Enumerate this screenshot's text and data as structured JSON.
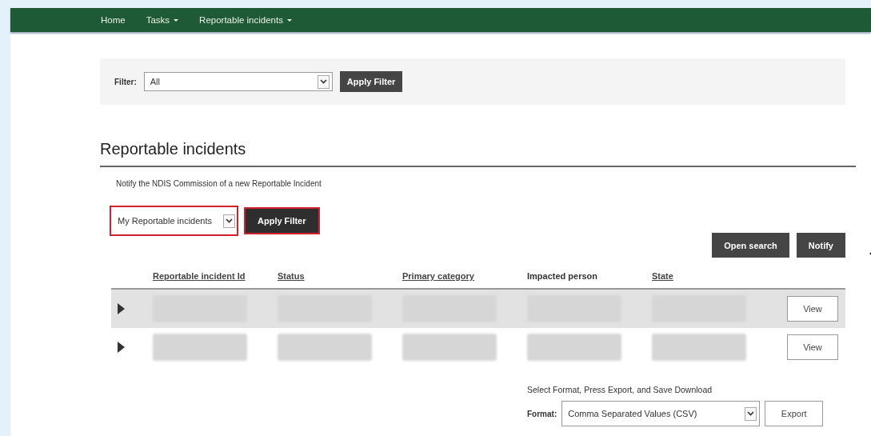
{
  "nav": [
    {
      "label": "Home",
      "dropdown": false
    },
    {
      "label": "Tasks",
      "dropdown": true
    },
    {
      "label": "Reportable incidents",
      "dropdown": true
    }
  ],
  "top_filter": {
    "label": "Filter:",
    "value": "All",
    "button": "Apply Filter"
  },
  "heading": "Reportable incidents",
  "notify_text": "Notify the NDIS Commission of a new Reportable Incident",
  "incident_filter": {
    "value": "My Reportable incidents",
    "button": "Apply Filter",
    "highlighted": true
  },
  "actions": [
    "Open search",
    "Notify"
  ],
  "table": {
    "columns": [
      {
        "label": "Reportable incident Id",
        "sortable": true
      },
      {
        "label": "Status",
        "sortable": true
      },
      {
        "label": "Primary category",
        "sortable": true
      },
      {
        "label": "Impacted person",
        "sortable": false
      },
      {
        "label": "State",
        "sortable": true
      }
    ],
    "rows": [
      {
        "highlighted": true,
        "expanded": false,
        "action": "View"
      },
      {
        "highlighted": false,
        "expanded": false,
        "action": "View"
      }
    ]
  },
  "export": {
    "hint": "Select Format, Press Export, and Save Download",
    "label": "Format:",
    "value": "Comma Separated Values (CSV)",
    "button": "Export"
  }
}
